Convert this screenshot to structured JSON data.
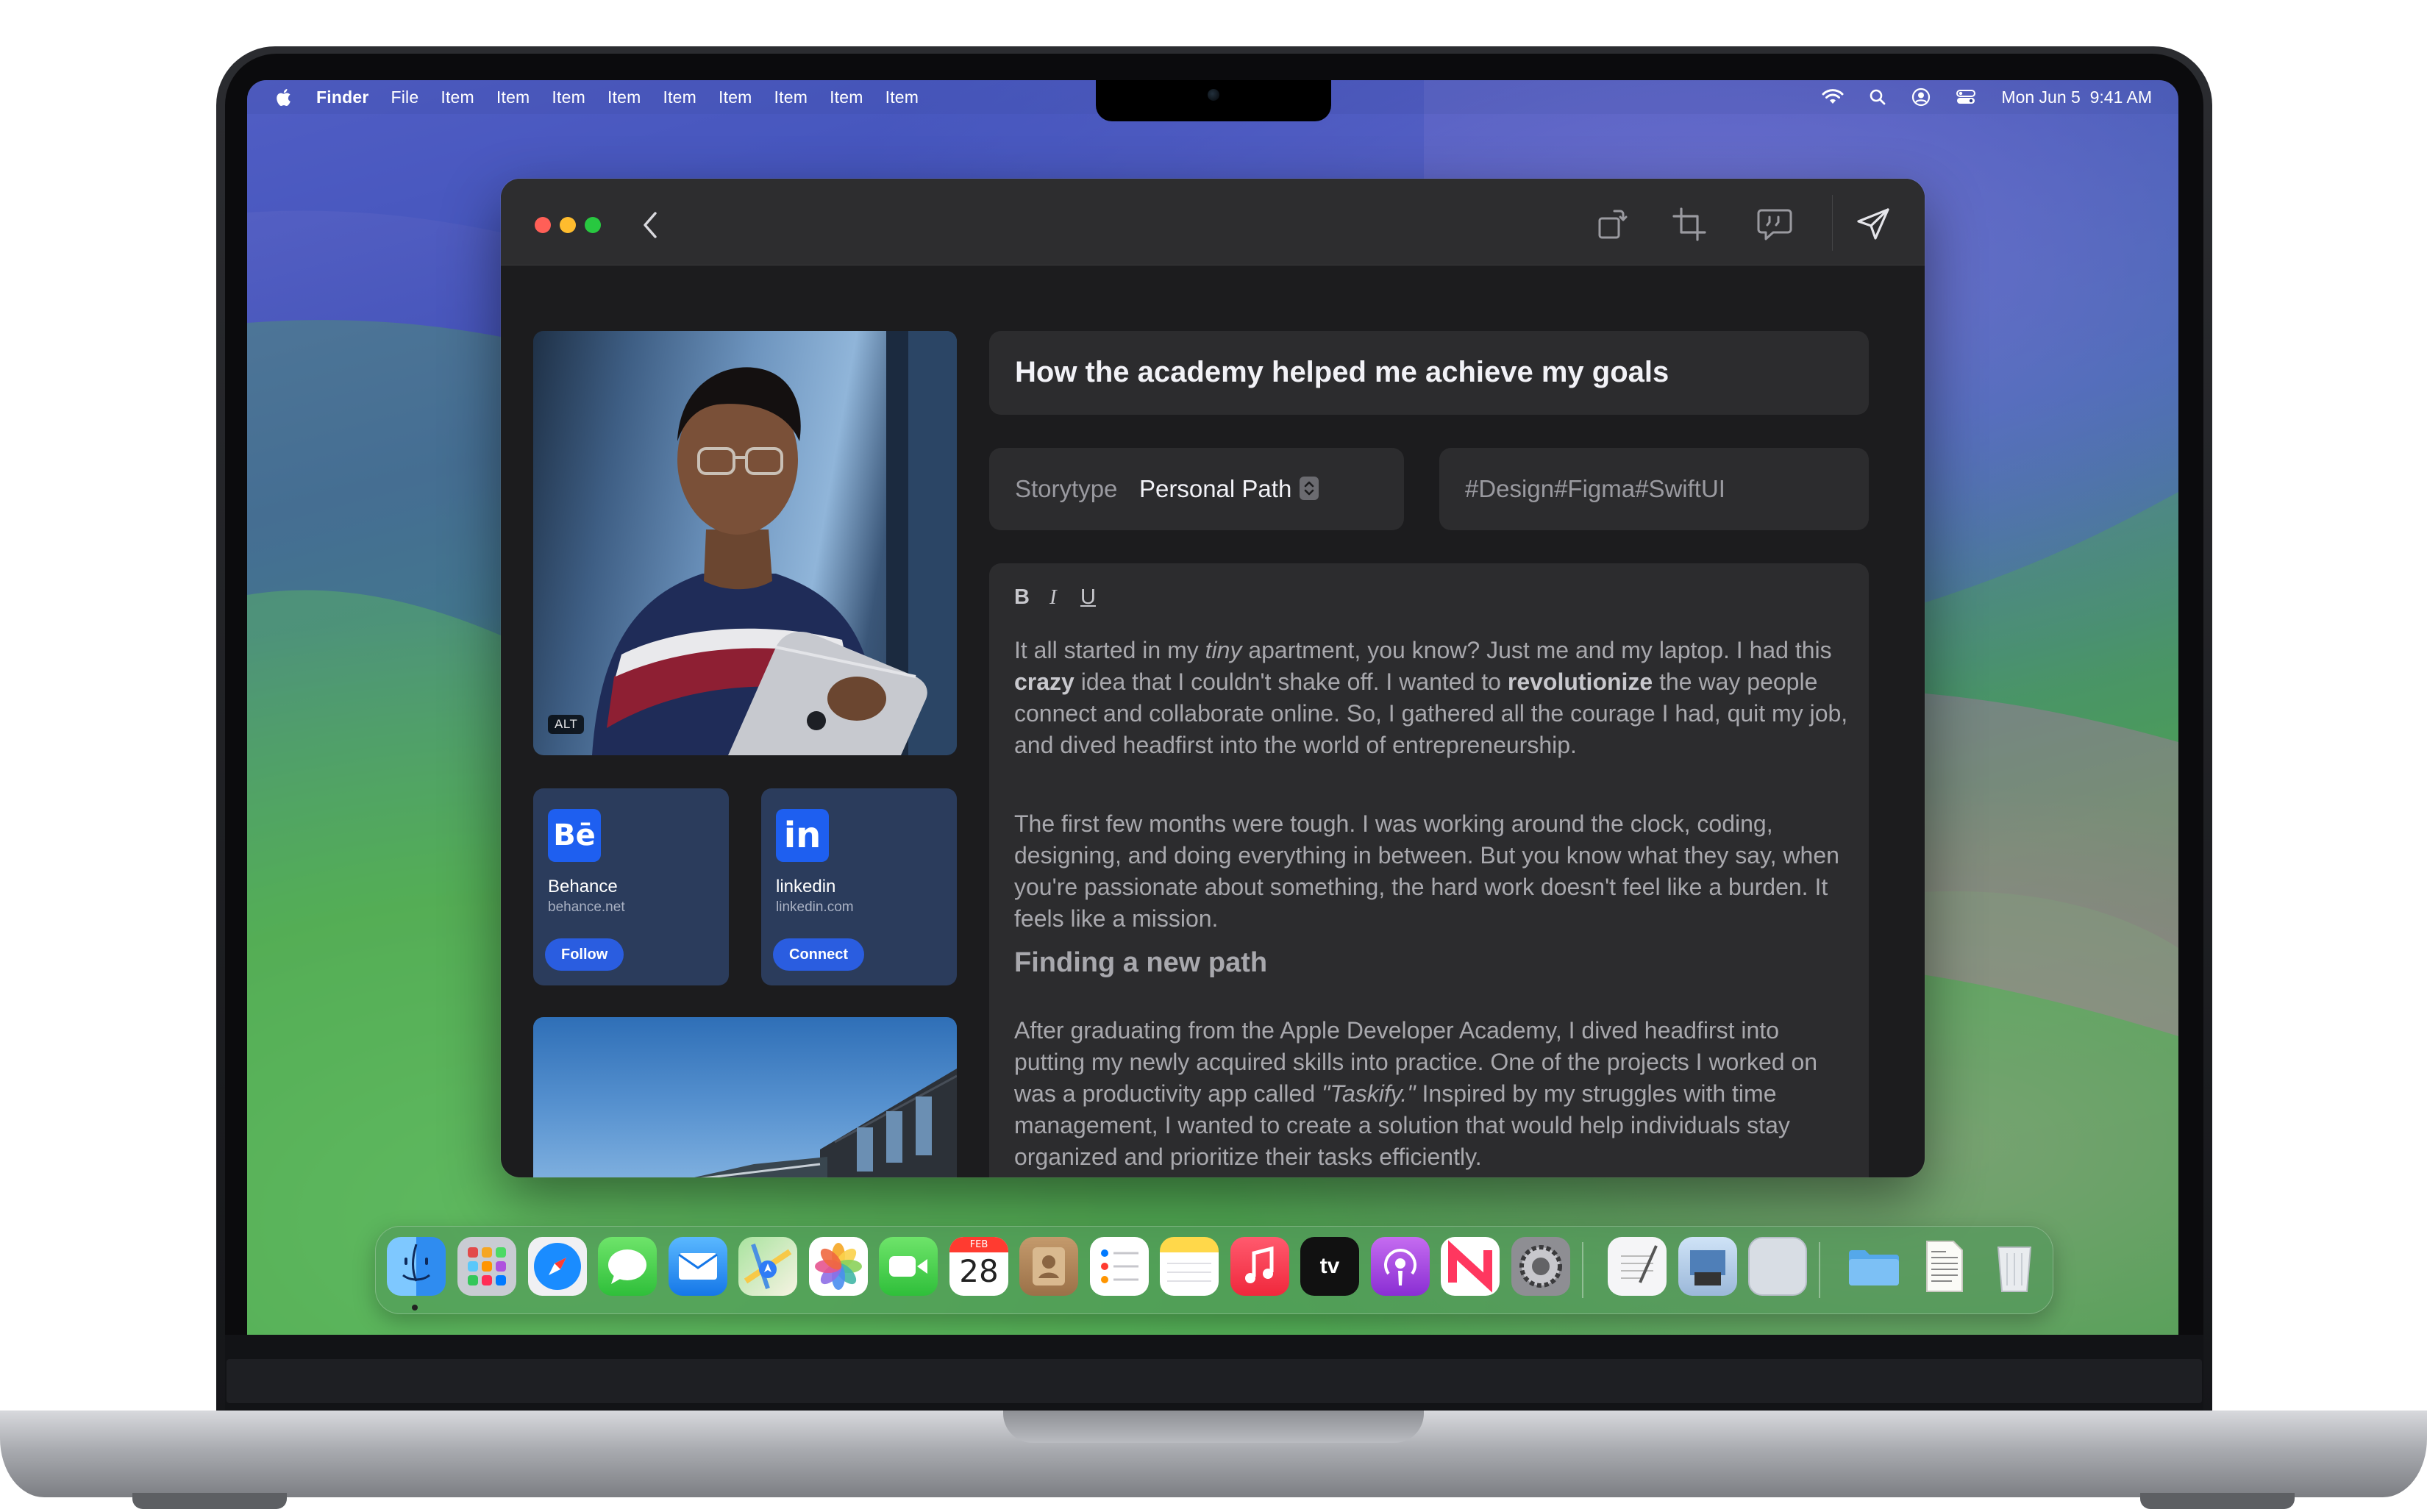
{
  "menubar": {
    "app_name": "Finder",
    "items": [
      "File",
      "Item",
      "Item",
      "Item",
      "Item",
      "Item",
      "Item",
      "Item",
      "Item",
      "Item"
    ],
    "clock": "Mon Jun 5  9:41 AM",
    "status_icons": [
      "wifi-icon",
      "search-icon",
      "user-icon",
      "control-center-icon"
    ]
  },
  "window": {
    "toolbar": [
      "back-icon",
      "rotate-icon",
      "crop-icon",
      "quote-bubble-icon",
      "send-icon"
    ],
    "photo": {
      "alt_badge": "ALT"
    },
    "social": [
      {
        "logo": "Bē",
        "name": "Behance",
        "domain": "behance.net",
        "button": "Follow",
        "color": "#1e5ff0"
      },
      {
        "logo": "in",
        "name": "linkedin",
        "domain": "linkedin.com",
        "button": "Connect",
        "color": "#1e5ff0"
      }
    ],
    "title": "How the academy helped me achieve my goals",
    "storytype": {
      "label": "Storytype",
      "value": "Personal Path"
    },
    "tags": "#Design#Figma#SwiftUI",
    "editor": {
      "format_buttons": [
        "B",
        "I",
        "U"
      ],
      "p1": {
        "a": "It all started in my ",
        "tiny": "tiny",
        "b": " apartment, you know? Just me and my laptop. I had this ",
        "crazy": "crazy",
        "c": " idea that I couldn't shake off. I wanted to ",
        "revolutionize": "revolutionize",
        "d": " the way people connect and collaborate online. So, I gathered all the courage I had, quit my job, and dived headfirst into the world of entrepreneurship."
      },
      "p2": "The first few months were tough. I was working around the clock, coding, designing, and doing everything in between. But you know what they say, when you're passionate about something, the hard work doesn't feel like a burden. It feels like a mission.",
      "heading": "Finding a new path",
      "p3": {
        "a": "After graduating from the Apple Developer Academy, I dived headfirst into putting my newly acquired skills into practice. One of the projects I worked on was a productivity app called ",
        "app": "\"Taskify.\"",
        "b": " Inspired by my struggles with time management, I wanted to create a solution that would help individuals stay organized and prioritize their tasks efficiently."
      }
    }
  },
  "dock": {
    "apps": [
      "finder-icon",
      "launchpad-icon",
      "safari-icon",
      "messages-icon",
      "mail-icon",
      "maps-icon",
      "photos-icon",
      "facetime-icon",
      "calendar-icon",
      "contacts-icon",
      "reminders-icon",
      "notes-icon",
      "music-icon",
      "apple-tv-icon",
      "podcasts-icon",
      "news-icon",
      "system-settings-icon",
      "textedit-icon",
      "preview-icon",
      "blank-app-icon",
      "folder-icon",
      "document-icon",
      "trash-icon"
    ],
    "calendar_month": "FEB",
    "calendar_day": "28",
    "tv_label": "tv"
  }
}
